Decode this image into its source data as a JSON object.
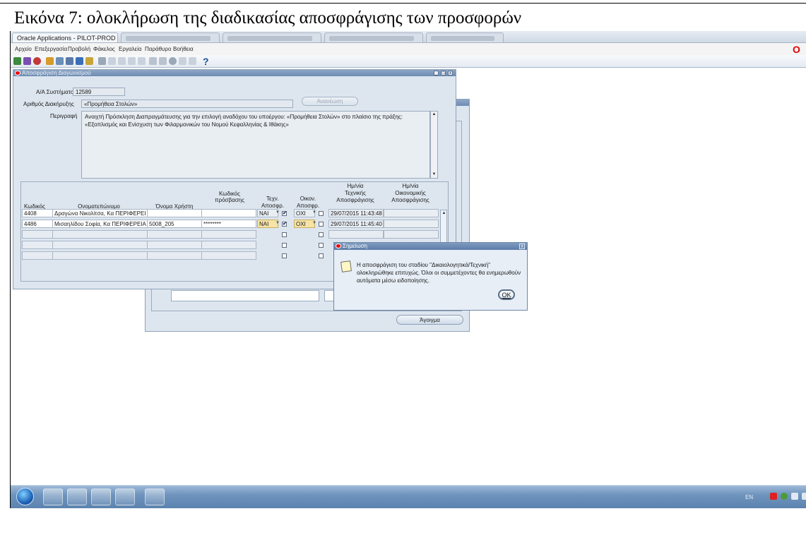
{
  "caption": "Εικόνα 7: ολοκλήρωση της διαδικασίας αποσφράγισης των προσφορών",
  "app_title": "Oracle Applications - PILOT-PROD",
  "menu": [
    "Αρχείο",
    "Επεξεργασία",
    "Προβολή",
    "Φάκελος",
    "Εργαλεία",
    "Παράθυρο",
    "Βοήθεια"
  ],
  "toolbar_help_icon": "?",
  "main_window": {
    "title": "Αποσφράγιση Διαγωνισμού",
    "system_id_label": "Α/Α Συστήματος",
    "system_id": "12589",
    "announcement_label": "Αριθμός Διακήρυξης",
    "announcement": "«Προμήθεια Στολών»",
    "refresh_label": "Ανανέωση",
    "description_label": "Περιγραφή",
    "description_line1": "Ανοιχτή Πρόσκληση Διαπραγμάτευσης για την επιλογή αναδόχου του υποέργου: «Προμήθεια Στολών» στο πλαίσιο της πράξης:",
    "description_line2": "«Εξοπλισμός και Ενίσχυση των Φιλαρμονικών του Νομού Κεφαλληνίας & Ιθάκης»"
  },
  "grid": {
    "headers": {
      "code": "Κωδικός",
      "name": "Ονοματεπώνυμο",
      "username": "Όνομα Χρήστη",
      "password_l1": "Κωδικός",
      "password_l2": "πρόσβασης",
      "tech_l1": "Τεχν.",
      "tech_l2": "Αποσφρ.",
      "econ_l1": "Οικον.",
      "econ_l2": "Αποσφρ.",
      "techdate_l1": "Ημ/νία",
      "techdate_l2": "Τεχνικής",
      "techdate_l3": "Αποσφράγισης",
      "econdate_l1": "Ημ/νία",
      "econdate_l2": "Οικονομικής",
      "econdate_l3": "Αποσφράγισης"
    },
    "rows": [
      {
        "code": "4408",
        "name": "Δραγώνα Νικολίτσα, Κα ΠΕΡΙΦΕΡΕΙ",
        "username": "",
        "password": "",
        "tech": "ΝΑΙ",
        "econ": "ΟΧΙ",
        "tech_date": "29/07/2015 11:43:48",
        "econ_date": ""
      },
      {
        "code": "4486",
        "name": "Μισαηλίδου Σοφία, Κα ΠΕΡΙΦΕΡΕΙΑ",
        "username": "5008_205",
        "password": "********",
        "tech": "ΝΑΙ",
        "econ": "ΟΧΙ",
        "tech_date": "29/07/2015 11:45:40",
        "econ_date": ""
      }
    ],
    "check_mark": "✔"
  },
  "back_window": {
    "release_label": "Άγοιγμα"
  },
  "alert": {
    "title": "Σημείωση",
    "message": "Η αποσφράγιση του σταδίου \"Δικαιολογητικά/Τεχνική\" ολοκληρώθηκε επιτυχώς. Όλοι οι συμμετέχοντες θα ενημερωθούν αυτόματα μέσω ειδοποίησης.",
    "ok_label": "OK",
    "close_glyph": "x"
  },
  "taskbar": {
    "tray_lang": "EN"
  },
  "colors": {
    "accent": "#6e8bb3",
    "window_bg": "#dde6ef",
    "selected_cell": "#f6e3a8",
    "oracle_red": "#e00000"
  }
}
